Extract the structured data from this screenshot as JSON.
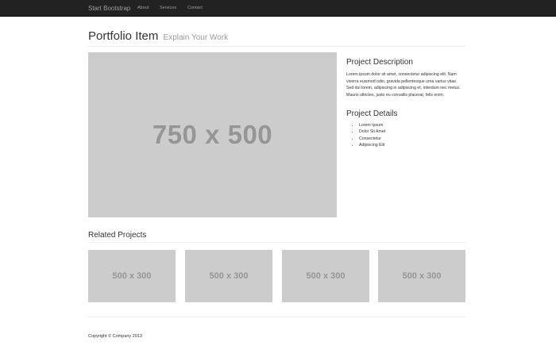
{
  "navbar": {
    "brand": "Start Bootstrap",
    "links": [
      "About",
      "Services",
      "Contact"
    ]
  },
  "header": {
    "title": "Portfolio Item",
    "subtitle": "Explain Your Work"
  },
  "main_image": {
    "label": "750 x 500"
  },
  "project_description": {
    "heading": "Project Description",
    "text": "Lorem ipsum dolor sit amet, consectetur adipiscing elit. Nam viverra euismod odio, gravida pellentesque urna varius vitae. Sed dui lorem, adipiscing in adipiscing et, interdum nec metus. Mauris ultricies, justo eu convallis placerat, felis enim."
  },
  "project_details": {
    "heading": "Project Details",
    "items": [
      "Lorem Ipsum",
      "Dolor Sit Amet",
      "Consectetur",
      "Adipiscing Elit"
    ]
  },
  "related": {
    "heading": "Related Projects",
    "thumbnails": [
      "500 x 300",
      "500 x 300",
      "500 x 300",
      "500 x 300"
    ]
  },
  "footer": {
    "copyright": "Copyright © Company 2013"
  },
  "colors": {
    "navbar_bg": "#222222",
    "nav_text": "#9d9d9d",
    "placeholder_bg": "#cccccc",
    "placeholder_text": "#969696",
    "subtitle_text": "#999999"
  }
}
